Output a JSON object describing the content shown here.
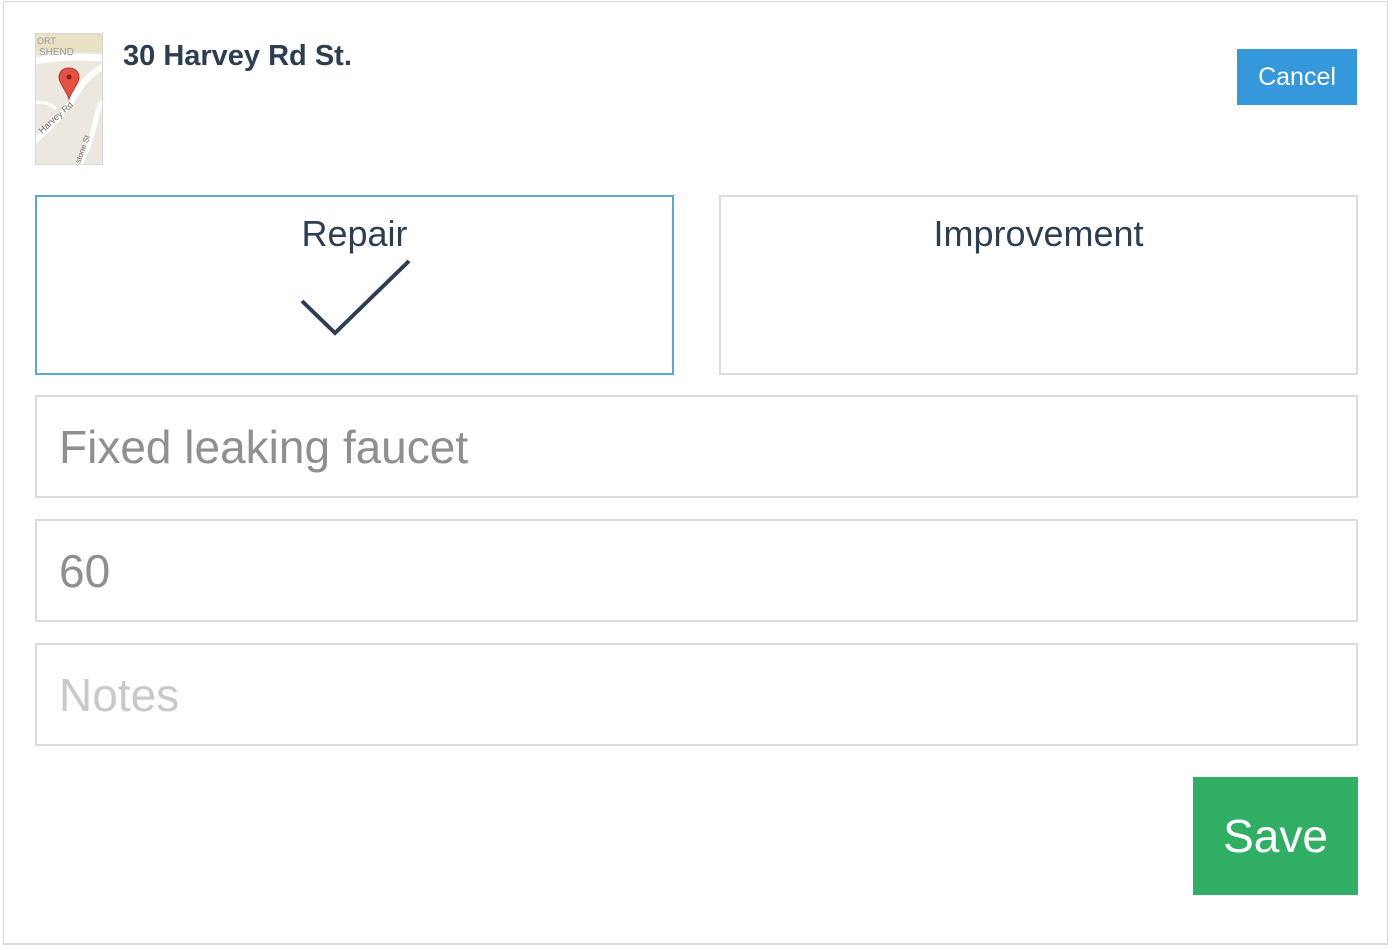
{
  "property": {
    "address": "30 Harvey Rd St.",
    "map_labels": [
      "ORT",
      "SHEND",
      "Harvey Rd",
      "stone St"
    ]
  },
  "actions": {
    "cancel_label": "Cancel",
    "save_label": "Save"
  },
  "type_options": [
    {
      "label": "Repair",
      "selected": true
    },
    {
      "label": "Improvement",
      "selected": false
    }
  ],
  "form": {
    "description_value": "Fixed leaking faucet",
    "amount_value": "60",
    "notes_value": "",
    "notes_placeholder": "Notes"
  },
  "colors": {
    "accent_blue": "#3498db",
    "save_green": "#2fae64",
    "text_dark": "#2c3e50",
    "map_pin": "#e25141"
  }
}
